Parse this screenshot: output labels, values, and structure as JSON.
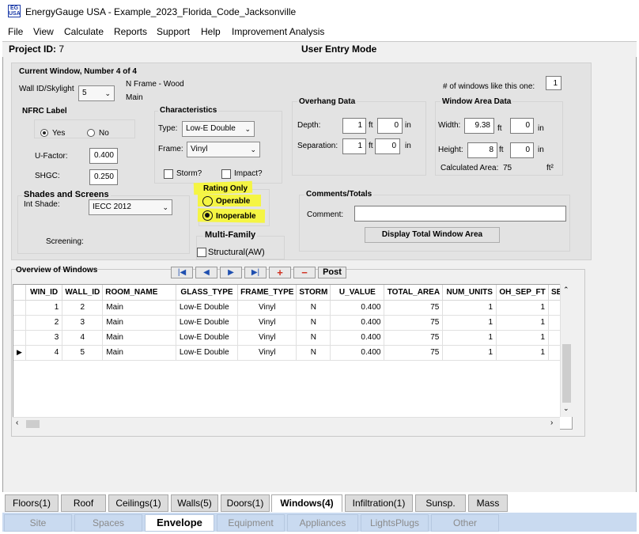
{
  "window": {
    "title": "EnergyGauge USA - Example_2023_Florida_Code_Jacksonville",
    "logo_text": "EG USA"
  },
  "menu": [
    "File",
    "View",
    "Calculate",
    "Reports",
    "Support",
    "Help",
    "Improvement Analysis"
  ],
  "header": {
    "project_id_label": "Project ID:",
    "project_id": "7",
    "mode": "User Entry Mode"
  },
  "form": {
    "current_window": "Current Window, Number 4 of 4",
    "wall_label": "Wall ID/Skylight",
    "wall_value": "5",
    "wall_desc1": "N  Frame - Wood",
    "wall_desc2": "Main",
    "num_windows_label": "# of windows like this one:",
    "num_windows": "1",
    "nfrc": {
      "title": "NFRC Label",
      "yes": "Yes",
      "no": "No",
      "selected": "Yes",
      "ufactor_label": "U-Factor:",
      "ufactor": "0.400",
      "shgc_label": "SHGC:",
      "shgc": "0.250"
    },
    "characteristics": {
      "title": "Characteristics",
      "type_label": "Type:",
      "type": "Low-E Double",
      "frame_label": "Frame:",
      "frame": "Vinyl",
      "storm": "Storm?",
      "impact": "Impact?"
    },
    "overhang": {
      "title": "Overhang Data",
      "depth_label": "Depth:",
      "depth_ft": "1",
      "depth_in": "0",
      "sep_label": "Separation:",
      "sep_ft": "1",
      "sep_in": "0",
      "ft": "ft",
      "in": "in"
    },
    "area": {
      "title": "Window Area Data",
      "width_label": "Width:",
      "width_ft": "9.38",
      "width_in": "0",
      "height_label": "Height:",
      "height_ft": "8",
      "height_in": "0",
      "calc_label": "Calculated Area:",
      "calc_value": "75",
      "unit": "ft²"
    },
    "shades": {
      "title": "Shades and Screens",
      "int_label": "Int Shade:",
      "int_value": "IECC 2012",
      "screening_label": "Screening:"
    },
    "rating": {
      "title": "Rating Only",
      "operable": "Operable",
      "inoperable": "Inoperable",
      "selected": "Inoperable"
    },
    "multifamily": {
      "title": "Multi-Family",
      "structural": "Structural(AW)"
    },
    "comments": {
      "title": "Comments/Totals",
      "comment_label": "Comment:",
      "comment_value": "",
      "display_button": "Display Total Window Area"
    }
  },
  "overview": {
    "title": "Overview of Windows",
    "nav": {
      "first": "|◀",
      "prev": "◀",
      "next": "▶",
      "last": "▶|",
      "add": "+",
      "remove": "−",
      "post": "Post"
    },
    "columns": [
      "WIN_ID",
      "WALL_ID",
      "ROOM_NAME",
      "GLASS_TYPE",
      "FRAME_TYPE",
      "STORM",
      "U_VALUE",
      "TOTAL_AREA",
      "NUM_UNITS",
      "OH_SEP_FT",
      "SE"
    ],
    "rows": [
      [
        "1",
        "2",
        "Main",
        "Low-E Double",
        "Vinyl",
        "N",
        "0.400",
        "75",
        "1",
        "1"
      ],
      [
        "2",
        "3",
        "Main",
        "Low-E Double",
        "Vinyl",
        "N",
        "0.400",
        "75",
        "1",
        "1"
      ],
      [
        "3",
        "4",
        "Main",
        "Low-E Double",
        "Vinyl",
        "N",
        "0.400",
        "75",
        "1",
        "1"
      ],
      [
        "4",
        "5",
        "Main",
        "Low-E Double",
        "Vinyl",
        "N",
        "0.400",
        "75",
        "1",
        "1"
      ]
    ],
    "current_row_marker": "▶"
  },
  "tabs_component": [
    "Floors(1)",
    "Roof",
    "Ceilings(1)",
    "Walls(5)",
    "Doors(1)",
    "Windows(4)",
    "Infiltration(1)",
    "Sunsp.",
    "Mass"
  ],
  "tabs_component_active": "Windows(4)",
  "tabs_section": [
    "Site",
    "Spaces",
    "Envelope",
    "Equipment",
    "Appliances",
    "LightsPlugs",
    "Other"
  ],
  "tabs_section_active": "Envelope",
  "colors": {
    "highlight": "#f5f543",
    "panel": "#e3e3e3",
    "section_tabs": "#c9daf0"
  }
}
